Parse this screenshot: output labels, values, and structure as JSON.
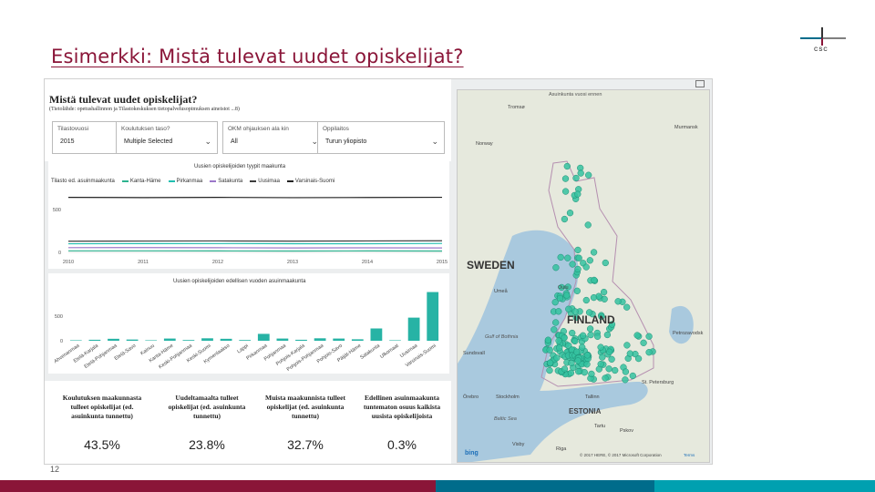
{
  "slide": {
    "title": "Esimerkki: Mistä tulevat uudet opiskelijat?",
    "page_number": "12",
    "logo_text": "CSC",
    "footer_colors": [
      "#8a1538",
      "#8a1538",
      "#006c8b",
      "#00a0b0"
    ]
  },
  "report": {
    "title": "Mistä tulevat uudet opiskelijat?",
    "subtitle": "(Tietolähde: opetushallinnon ja Tilastokeskuksen tietopalvelusopimuksen aineistot ...8)",
    "slicers": [
      {
        "label": "Tilastovuosi",
        "value": "2015"
      },
      {
        "label": "Koulutuksen taso?",
        "value": "Multiple Selected"
      },
      {
        "label": "OKM ohjauksen ala kin",
        "value": "All"
      },
      {
        "label": "Oppilaitos",
        "value": "Turun yliopisto"
      }
    ],
    "expand_icon": "expand-icon"
  },
  "chart_data": [
    {
      "type": "line",
      "title": "Uusien opiskelijoiden tyypit maakunta",
      "legend_title": "Tilasto ed. asuinmaakunta",
      "x": [
        2010,
        2011,
        2012,
        2013,
        2014,
        2015
      ],
      "ytick_labels": [
        "500",
        "0"
      ],
      "ylim": [
        0,
        700
      ],
      "series": [
        {
          "name": "Kanta-Häme",
          "color": "#2db38f",
          "values": [
            18,
            18,
            17,
            16,
            17,
            16
          ]
        },
        {
          "name": "Pirkanmaa",
          "color": "#1fbfb0",
          "values": [
            100,
            102,
            103,
            101,
            100,
            104
          ]
        },
        {
          "name": "Satakunta",
          "color": "#9b77c9",
          "values": [
            55,
            56,
            54,
            52,
            53,
            52
          ]
        },
        {
          "name": "Uusimaa",
          "color": "#3c3c3c",
          "values": [
            130,
            132,
            133,
            131,
            133,
            135
          ]
        },
        {
          "name": "Varsinais-Suomi",
          "color": "#222222",
          "values": [
            640,
            638,
            640,
            637,
            639,
            641
          ]
        }
      ]
    },
    {
      "type": "bar",
      "title": "Uusien opiskelijoiden edellisen vuoden asuinmaakunta",
      "ytick_labels": [
        "500",
        "0"
      ],
      "ylim": [
        0,
        1000
      ],
      "color": "#27b3a5",
      "categories": [
        "Ahvenanmaa",
        "Etelä-Karjala",
        "Etelä-Pohjanmaa",
        "Etelä-Savo",
        "Kainuu",
        "Kanta-Häme",
        "Keski-Pohjanmaa",
        "Keski-Suomi",
        "Kymenlaakso",
        "Lappi",
        "Pirkanmaa",
        "Pohjanmaa",
        "Pohjois-Karjala",
        "Pohjois-Pohjanmaa",
        "Pohjois-Savo",
        "Päijät-Häme",
        "Satakunta",
        "Ulkomaat",
        "Uusimaa",
        "Varsinais-Suomi"
      ],
      "values": [
        10,
        20,
        40,
        25,
        10,
        45,
        15,
        50,
        40,
        15,
        140,
        45,
        20,
        50,
        45,
        30,
        250,
        10,
        470,
        990
      ]
    }
  ],
  "kpis": [
    {
      "desc": "Koulutuksen maakunnasta tulleet opiskelijat (ed. asuinkunta tunnettu)",
      "value": "43.5%"
    },
    {
      "desc": "Uudeltamaalta tulleet opiskelijat (ed. asuinkunta tunnettu)",
      "value": "23.8%"
    },
    {
      "desc": "Muista maakunnista tulleet opiskelijat (ed. asuinkunta tunnettu)",
      "value": "32.7%"
    },
    {
      "desc": "Edellinen asuinmaakunta tuntematon osuus kaikista uusista opiskelijoista",
      "value": "0.3%"
    }
  ],
  "map": {
    "title": "Asuinkunta vuosi ennen",
    "labels": [
      {
        "text": "SWEDEN",
        "size": "big"
      },
      {
        "text": "FINLAND",
        "size": "big"
      },
      {
        "text": "ESTONIA",
        "size": "mid"
      },
      {
        "text": "St. Petersburg",
        "size": "small"
      },
      {
        "text": "Stockholm",
        "size": "small"
      },
      {
        "text": "Murmansk",
        "size": "small"
      },
      {
        "text": "Gulf of Bothnia",
        "size": "small"
      },
      {
        "text": "Baltic Sea",
        "size": "small"
      },
      {
        "text": "Oulu",
        "size": "small"
      },
      {
        "text": "Tallinn",
        "size": "small"
      },
      {
        "text": "Riga",
        "size": "small"
      },
      {
        "text": "Pskov",
        "size": "small"
      },
      {
        "text": "Tromsø",
        "size": "small"
      },
      {
        "text": "Norway",
        "size": "small"
      },
      {
        "text": "Umeå",
        "size": "small"
      },
      {
        "text": "Örebro",
        "size": "small"
      },
      {
        "text": "Visby",
        "size": "small"
      },
      {
        "text": "Petrozavodsk",
        "size": "small"
      },
      {
        "text": "Sundsvall",
        "size": "small"
      },
      {
        "text": "Tartu",
        "size": "small"
      }
    ],
    "bing_label": "bing",
    "copyright": "© 2017 HERE, © 2017 Microsoft Corporation",
    "terms": "Terms",
    "marker_color": "#35c2a0"
  }
}
